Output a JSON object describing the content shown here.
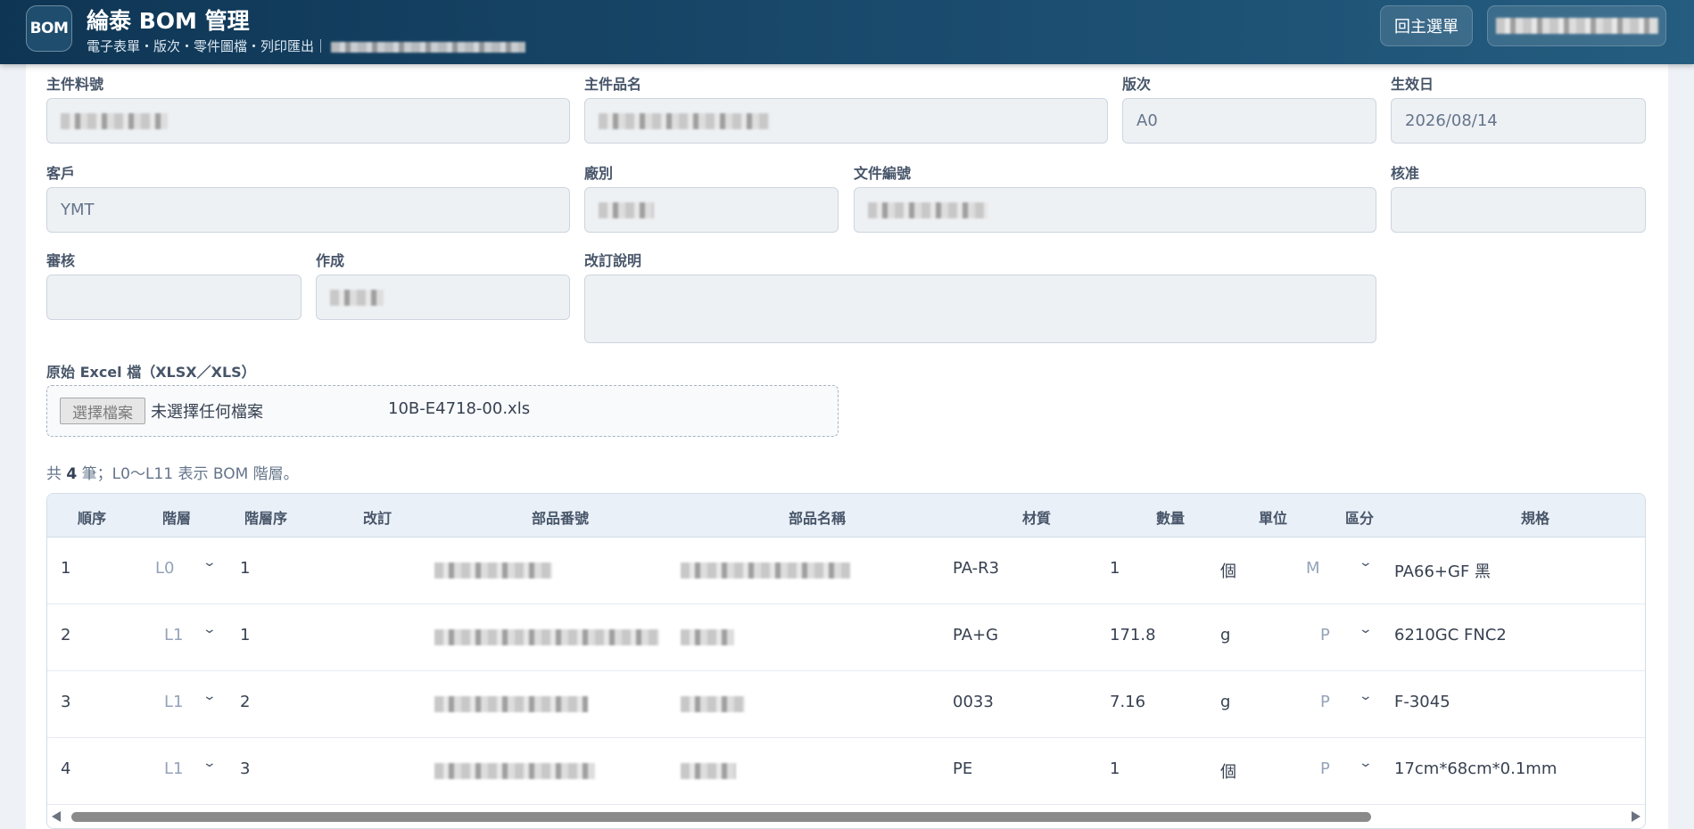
{
  "header": {
    "logo": "BOM",
    "title": "綸泰 BOM 管理",
    "subtitle": "電子表單・版次・零件圖檔・列印匯出｜",
    "home_button": "回主選單"
  },
  "form": {
    "main_part_no_label": "主件料號",
    "main_part_name_label": "主件品名",
    "version_label": "版次",
    "version_value": "A0",
    "effective_date_label": "生效日",
    "effective_date_value": "2026/08/14",
    "customer_label": "客戶",
    "customer_value": "YMT",
    "factory_label": "廠別",
    "doc_no_label": "文件編號",
    "approval_label": "核准",
    "review_label": "審核",
    "author_label": "作成",
    "revision_note_label": "改訂說明",
    "excel_label": "原始 Excel 檔（XLSX／XLS）",
    "file_button": "選擇檔案",
    "file_none": "未選擇任何檔案",
    "file_name": "10B-E4718-00.xls"
  },
  "summary": {
    "prefix": "共",
    "count": "4",
    "suffix": "筆；L0～L11 表示 BOM 階層。"
  },
  "table": {
    "headers": [
      "順序",
      "階層",
      "階層序",
      "改訂",
      "部品番號",
      "部品名稱",
      "材質",
      "數量",
      "單位",
      "區分",
      "規格"
    ],
    "rows": [
      {
        "seq": "1",
        "level": "L0",
        "level_seq": "1",
        "material": "PA-R3",
        "qty": "1",
        "unit": "個",
        "category": "M",
        "spec": "PA66+GF 黑"
      },
      {
        "seq": "2",
        "level": "L1",
        "level_seq": "1",
        "material": "PA+G",
        "qty": "171.8",
        "unit": "g",
        "category": "P",
        "spec": "6210GC FNC2"
      },
      {
        "seq": "3",
        "level": "L1",
        "level_seq": "2",
        "material": "0033",
        "qty": "7.16",
        "unit": "g",
        "category": "P",
        "spec": "F-3045"
      },
      {
        "seq": "4",
        "level": "L1",
        "level_seq": "3",
        "material": "PE",
        "qty": "1",
        "unit": "個",
        "category": "P",
        "spec": "17cm*68cm*0.1mm"
      }
    ]
  }
}
